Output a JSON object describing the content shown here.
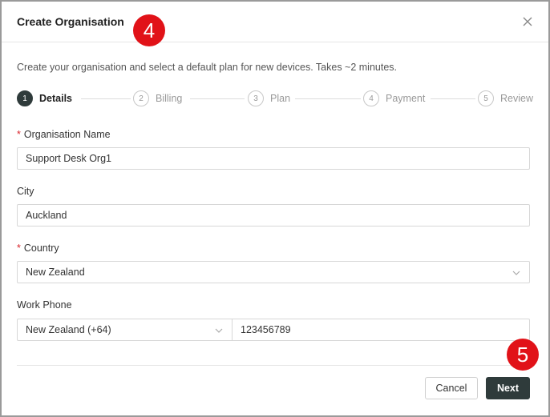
{
  "dialog": {
    "title": "Create Organisation",
    "description": "Create your organisation and select a default plan for new devices. Takes ~2 minutes."
  },
  "annotations": {
    "badge_top": "4",
    "badge_bottom": "5",
    "badge_color": "#e11218"
  },
  "steps": [
    {
      "number": "1",
      "label": "Details",
      "active": true
    },
    {
      "number": "2",
      "label": "Billing",
      "active": false
    },
    {
      "number": "3",
      "label": "Plan",
      "active": false
    },
    {
      "number": "4",
      "label": "Payment",
      "active": false
    },
    {
      "number": "5",
      "label": "Review",
      "active": false
    }
  ],
  "form": {
    "required_mark": "*",
    "org_name": {
      "label": "Organisation Name",
      "value": "Support Desk Org1",
      "required": true
    },
    "city": {
      "label": "City",
      "value": "Auckland",
      "required": false
    },
    "country": {
      "label": "Country",
      "value": "New Zealand",
      "required": true
    },
    "work_phone": {
      "label": "Work Phone",
      "country_value": "New Zealand (+64)",
      "number_value": "123456789"
    }
  },
  "footer": {
    "cancel_label": "Cancel",
    "next_label": "Next"
  },
  "colors": {
    "primary": "#2f3b3b",
    "required": "#d9262d",
    "border": "#d7d7d7"
  },
  "icons": {
    "close": "close-icon",
    "chevron": "chevron-down-icon"
  }
}
